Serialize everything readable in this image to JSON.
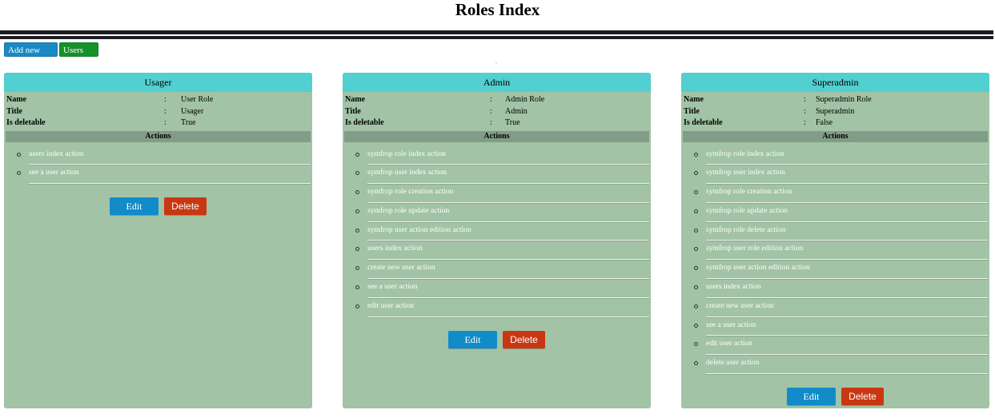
{
  "page": {
    "title": "Roles Index",
    "add_role_label": "Add new role",
    "users_list_label": "Users list",
    "dot": "."
  },
  "labels": {
    "name": "Name",
    "title": "Title",
    "is_deletable": "Is deletable",
    "separator": ":",
    "actions": "Actions",
    "edit": "Edit",
    "delete": "Delete"
  },
  "colors": {
    "card_background": "#a2c3a5",
    "card_header": "#52cfd0",
    "actions_header": "#829d87",
    "edit_button": "#128bc9",
    "delete_button": "#c83711",
    "add_button": "#1a8ac4",
    "users_button": "#14922a"
  },
  "roles": [
    {
      "header": "Usager",
      "name": "User Role",
      "title": "Usager",
      "is_deletable": "True",
      "actions": [
        "users index action",
        "see a user action"
      ]
    },
    {
      "header": "Admin",
      "name": "Admin Role",
      "title": "Admin",
      "is_deletable": "True",
      "actions": [
        "symfrop role index action",
        "symfrop user index action",
        "symfrop role creation action",
        "symfrop role update action",
        "symfrop user action edition action",
        "users index action",
        "create new user action",
        "see a user action",
        "edit user action"
      ]
    },
    {
      "header": "Superadmin",
      "name": "Superadmin Role",
      "title": "Superadmin",
      "is_deletable": "False",
      "actions": [
        "symfrop role index action",
        "symfrop user index action",
        "symfrop role creation action",
        "symfrop role update action",
        "symfrop role delete action",
        "symfrop user role edition action",
        "symfrop user action edition action",
        "users index action",
        "create new user action",
        "see a user action",
        "edit user action",
        "delete user action"
      ]
    }
  ]
}
